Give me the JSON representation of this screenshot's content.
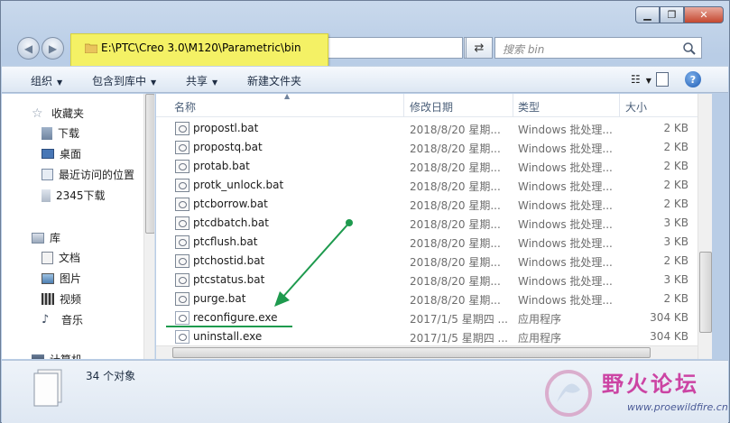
{
  "window": {
    "min_glyph": "▁",
    "max_glyph": "❐",
    "close_glyph": "✕"
  },
  "address": {
    "path": "E:\\PTC\\Creo 3.0\\M120\\Parametric\\bin"
  },
  "search": {
    "placeholder": "搜索 bin"
  },
  "toolbar": {
    "organize": "组织",
    "include_in_library": "包含到库中",
    "share": "共享",
    "new_folder": "新建文件夹",
    "help": "?"
  },
  "nav": {
    "favorites": "收藏夹",
    "downloads": "下载",
    "desktop": "桌面",
    "recent": "最近访问的位置",
    "downloads_2345": "2345下载",
    "libraries": "库",
    "documents": "文档",
    "pictures": "图片",
    "videos": "视频",
    "music": "音乐",
    "computer": "计算机"
  },
  "columns": {
    "name": "名称",
    "date": "修改日期",
    "type": "类型",
    "size": "大小"
  },
  "files": [
    {
      "name": "propostl.bat",
      "date": "2018/8/20 星期...",
      "type": "Windows 批处理...",
      "size": "2 KB"
    },
    {
      "name": "propostq.bat",
      "date": "2018/8/20 星期...",
      "type": "Windows 批处理...",
      "size": "2 KB"
    },
    {
      "name": "protab.bat",
      "date": "2018/8/20 星期...",
      "type": "Windows 批处理...",
      "size": "2 KB"
    },
    {
      "name": "protk_unlock.bat",
      "date": "2018/8/20 星期...",
      "type": "Windows 批处理...",
      "size": "2 KB"
    },
    {
      "name": "ptcborrow.bat",
      "date": "2018/8/20 星期...",
      "type": "Windows 批处理...",
      "size": "2 KB"
    },
    {
      "name": "ptcdbatch.bat",
      "date": "2018/8/20 星期...",
      "type": "Windows 批处理...",
      "size": "3 KB"
    },
    {
      "name": "ptcflush.bat",
      "date": "2018/8/20 星期...",
      "type": "Windows 批处理...",
      "size": "3 KB"
    },
    {
      "name": "ptchostid.bat",
      "date": "2018/8/20 星期...",
      "type": "Windows 批处理...",
      "size": "2 KB"
    },
    {
      "name": "ptcstatus.bat",
      "date": "2018/8/20 星期...",
      "type": "Windows 批处理...",
      "size": "3 KB"
    },
    {
      "name": "purge.bat",
      "date": "2018/8/20 星期...",
      "type": "Windows 批处理...",
      "size": "2 KB"
    },
    {
      "name": "reconfigure.exe",
      "date": "2017/1/5 星期四 ...",
      "type": "应用程序",
      "size": "304 KB"
    },
    {
      "name": "uninstall.exe",
      "date": "2017/1/5 星期四 ...",
      "type": "应用程序",
      "size": "304 KB"
    }
  ],
  "status": {
    "count": "34 个对象"
  },
  "watermark": {
    "title": "野火论坛",
    "url": "www.proewildfire.cn"
  },
  "colors": {
    "highlight": "#f4f165",
    "arrow": "#1e9a4e",
    "underline": "#1e9a4e",
    "watermark": "#c9329b"
  }
}
